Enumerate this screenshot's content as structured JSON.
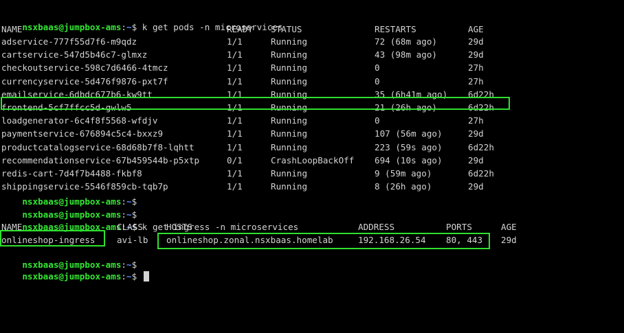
{
  "prompt": {
    "user_host": "nsxbaas@jumpbox-ams",
    "sep": ":",
    "path": "~",
    "symbol": "$"
  },
  "commands": {
    "get_pods": "k get pods -n microservices",
    "get_ingress": "k get ingress -n microservices"
  },
  "pods": {
    "headers": [
      "NAME",
      "READY",
      "STATUS",
      "RESTARTS",
      "AGE"
    ],
    "rows": [
      [
        "adservice-777f55d7f6-m9qdz",
        "1/1",
        "Running",
        "72 (68m ago)",
        "29d"
      ],
      [
        "cartservice-547d5b46c7-glmxz",
        "1/1",
        "Running",
        "43 (98m ago)",
        "29d"
      ],
      [
        "checkoutservice-598c7d6466-4tmcz",
        "1/1",
        "Running",
        "0",
        "27h"
      ],
      [
        "currencyservice-5d476f9876-pxt7f",
        "1/1",
        "Running",
        "0",
        "27h"
      ],
      [
        "emailservice-6dbdc677b6-kw9tt",
        "1/1",
        "Running",
        "35 (6h41m ago)",
        "6d22h"
      ],
      [
        "frontend-5cf7ffcc5d-gwlw5",
        "1/1",
        "Running",
        "21 (26h ago)",
        "6d22h"
      ],
      [
        "loadgenerator-6c4f8f5568-wfdjv",
        "1/1",
        "Running",
        "0",
        "27h"
      ],
      [
        "paymentservice-676894c5c4-bxxz9",
        "1/1",
        "Running",
        "107 (56m ago)",
        "29d"
      ],
      [
        "productcatalogservice-68d68b7f8-lqhtt",
        "1/1",
        "Running",
        "223 (59s ago)",
        "6d22h"
      ],
      [
        "recommendationservice-67b459544b-p5xtp",
        "0/1",
        "CrashLoopBackOff",
        "694 (10s ago)",
        "29d"
      ],
      [
        "redis-cart-7d4f7b4488-fkbf8",
        "1/1",
        "Running",
        "9 (59m ago)",
        "6d22h"
      ],
      [
        "shippingservice-5546f859cb-tqb7p",
        "1/1",
        "Running",
        "8 (26h ago)",
        "29d"
      ]
    ]
  },
  "ingress": {
    "headers": [
      "NAME",
      "CLASS",
      "HOSTS",
      "ADDRESS",
      "PORTS",
      "AGE"
    ],
    "rows": [
      [
        "onlineshop-ingress",
        "avi-lb",
        "onlineshop.zonal.nsxbaas.homelab",
        "192.168.26.54",
        "80, 443",
        "29d"
      ]
    ]
  },
  "colors": {
    "background": "#000000",
    "text": "#d4d4d4",
    "prompt_user": "#33e633",
    "prompt_path": "#5a8cff",
    "highlight_box": "#2fe02f"
  }
}
